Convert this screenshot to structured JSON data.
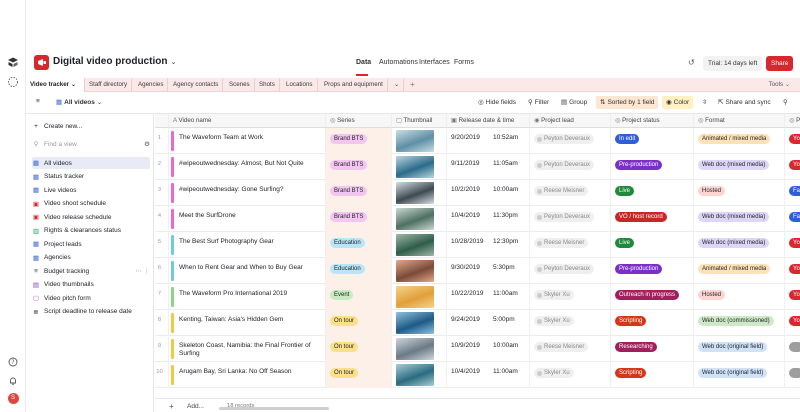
{
  "app": {
    "base_name": "Digital video production",
    "top_tabs": [
      "Data",
      "Automations",
      "Interfaces",
      "Forms"
    ],
    "trial": "Trial: 14 days left",
    "share": "Share"
  },
  "tables": {
    "items": [
      "Video tracker",
      "Staff directory",
      "Agencies",
      "Agency contacts",
      "Scenes",
      "Shots",
      "Locations",
      "Props and equipment"
    ],
    "tools": "Tools"
  },
  "viewbar": {
    "view_name": "All videos",
    "hide_fields": "Hide fields",
    "filter": "Filter",
    "group": "Group",
    "sorted": "Sorted by 1 field",
    "color": "Color",
    "share_sync": "Share and sync"
  },
  "sidebar": {
    "create_new": "Create new...",
    "find_placeholder": "Find a view",
    "views": [
      {
        "label": "All videos",
        "icon": "grid-icon",
        "color": "#3b66d6"
      },
      {
        "label": "Status tracker",
        "icon": "grid-icon",
        "color": "#3b66d6"
      },
      {
        "label": "Live videos",
        "icon": "grid-icon",
        "color": "#3b66d6"
      },
      {
        "label": "Video shoot schedule",
        "icon": "calendar-icon",
        "color": "#d9272e"
      },
      {
        "label": "Video release schedule",
        "icon": "calendar-icon",
        "color": "#d9272e"
      },
      {
        "label": "Rights & clearances status",
        "icon": "kanban-icon",
        "color": "#19a35b"
      },
      {
        "label": "Project leads",
        "icon": "grid-icon",
        "color": "#3b66d6"
      },
      {
        "label": "Agencies",
        "icon": "grid-icon",
        "color": "#3b66d6"
      },
      {
        "label": "Budget tracking",
        "icon": "gantt-icon",
        "color": "#444444"
      },
      {
        "label": "Video thumbnails",
        "icon": "gallery-icon",
        "color": "#7b3fc4"
      },
      {
        "label": "Video pitch form",
        "icon": "form-icon",
        "color": "#d94fa8"
      },
      {
        "label": "Script deadline to release date",
        "icon": "timeline-icon",
        "color": "#444444"
      }
    ]
  },
  "columns": {
    "name": "Video name",
    "series": "Series",
    "thumbnail": "Thumbnail",
    "release": "Release date & time",
    "lead": "Project lead",
    "status": "Project status",
    "format": "Format",
    "extra": "P"
  },
  "rows": [
    {
      "num": "1",
      "bar": "#e66ad0",
      "name": "The Waveform Team at Work",
      "series": "Brand BTS",
      "series_color": "#f3c6ef",
      "date": "9/20/2019",
      "time": "10:52am",
      "lead": "Peyton Deveraux",
      "status": "In edit",
      "status_color": "#2f5ed9",
      "format": "Animated / mixed media",
      "format_color": "#fde2b8",
      "thumb": [
        "#5f8fa6",
        "#c8dde3"
      ]
    },
    {
      "num": "2",
      "bar": "#e66ad0",
      "name": "#wipeoutwednesday: Almost, But Not Quite",
      "series": "Brand BTS",
      "series_color": "#f3c6ef",
      "date": "9/11/2019",
      "time": "11:05am",
      "lead": "Peyton Deveraux",
      "status": "Pre-production",
      "status_color": "#7b2fc8",
      "format": "Web doc (mixed media)",
      "format_color": "#ddd6f7",
      "thumb": [
        "#2b6a8a",
        "#b9d6df"
      ]
    },
    {
      "num": "3",
      "bar": "#e66ad0",
      "name": "#wipeoutwednesday: Gone Surfing?",
      "series": "Brand BTS",
      "series_color": "#f3c6ef",
      "date": "10/2/2019",
      "time": "10:00am",
      "lead": "Reese Meisner",
      "status": "Live",
      "status_color": "#1f8a3a",
      "format": "Hosted",
      "format_color": "#fbd5d3",
      "thumb": [
        "#3e4a52",
        "#d7dde0"
      ]
    },
    {
      "num": "4",
      "bar": "#e66ad0",
      "name": "Meet the SurfDrone",
      "series": "Brand BTS",
      "series_color": "#f3c6ef",
      "date": "10/4/2019",
      "time": "11:30pm",
      "lead": "Peyton Deveraux",
      "status": "VO / host record",
      "status_color": "#c62828",
      "format": "Web doc (mixed media)",
      "format_color": "#ddd6f7",
      "thumb": [
        "#4f6f62",
        "#cbd9d2"
      ]
    },
    {
      "num": "5",
      "bar": "#72c9e6",
      "name": "The Best Surf Photography Gear",
      "series": "Education",
      "series_color": "#b9e6f7",
      "date": "10/28/2019",
      "time": "12:30pm",
      "lead": "Reese Meisner",
      "status": "Live",
      "status_color": "#1f8a3a",
      "format": "Web doc (mixed media)",
      "format_color": "#ddd6f7",
      "thumb": [
        "#2f5c4a",
        "#9fb8a9"
      ]
    },
    {
      "num": "6",
      "bar": "#72c9e6",
      "name": "When to Rent Gear and When to Buy Gear",
      "series": "Education",
      "series_color": "#b9e6f7",
      "date": "9/30/2019",
      "time": "5:30pm",
      "lead": "Peyton Deveraux",
      "status": "Pre-production",
      "status_color": "#7b2fc8",
      "format": "Animated / mixed media",
      "format_color": "#fde2b8",
      "thumb": [
        "#7a4a3a",
        "#e3a889"
      ]
    },
    {
      "num": "7",
      "bar": "#8ed48a",
      "name": "The Waveform Pro International 2019",
      "series": "Event",
      "series_color": "#c8ecc0",
      "date": "10/22/2019",
      "time": "11:00am",
      "lead": "Skyler Xu",
      "status": "Outreach in progress",
      "status_color": "#a01f5c",
      "format": "Hosted",
      "format_color": "#fbd5d3",
      "thumb": [
        "#e0a03a",
        "#f6d38a"
      ]
    },
    {
      "num": "8",
      "bar": "#f5c842",
      "name": "Kenting, Taiwan: Asia's Hidden Gem",
      "series": "On tour",
      "series_color": "#fbe08a",
      "date": "9/24/2019",
      "time": "5:00pm",
      "lead": "Skyler Xu",
      "status": "Scripting",
      "status_color": "#d4361b",
      "format": "Web doc (commissioned)",
      "format_color": "#cfe9c8",
      "thumb": [
        "#1e5a85",
        "#8fc0df"
      ]
    },
    {
      "num": "9",
      "bar": "#f5c842",
      "name": "Skeleton Coast, Namibia: the Final Frontier of Surfing",
      "series": "On tour",
      "series_color": "#fbe08a",
      "date": "10/9/2019",
      "time": "10:00am",
      "lead": "Reese Meisner",
      "status": "Researching",
      "status_color": "#a01f5c",
      "format": "Web doc (original field)",
      "format_color": "#cfe2f7",
      "thumb": [
        "#6b7a86",
        "#cfd6dc"
      ]
    },
    {
      "num": "10",
      "bar": "#f5c842",
      "name": "Arugam Bay, Sri Lanka: No Off Season",
      "series": "On tour",
      "series_color": "#fbe08a",
      "date": "10/4/2019",
      "time": "11:00am",
      "lead": "Skyler Xu",
      "status": "Scripting",
      "status_color": "#d4361b",
      "format": "Web doc (original field)",
      "format_color": "#cfe2f7",
      "thumb": [
        "#2a6b7f",
        "#a9cdd6"
      ]
    }
  ],
  "footer": {
    "add": "Add...",
    "records": "18 records"
  },
  "edge_tags": [
    "Yo",
    "Yo",
    "Fa",
    "Fa",
    "Yo",
    "Yo",
    "Yo",
    "Yo"
  ]
}
